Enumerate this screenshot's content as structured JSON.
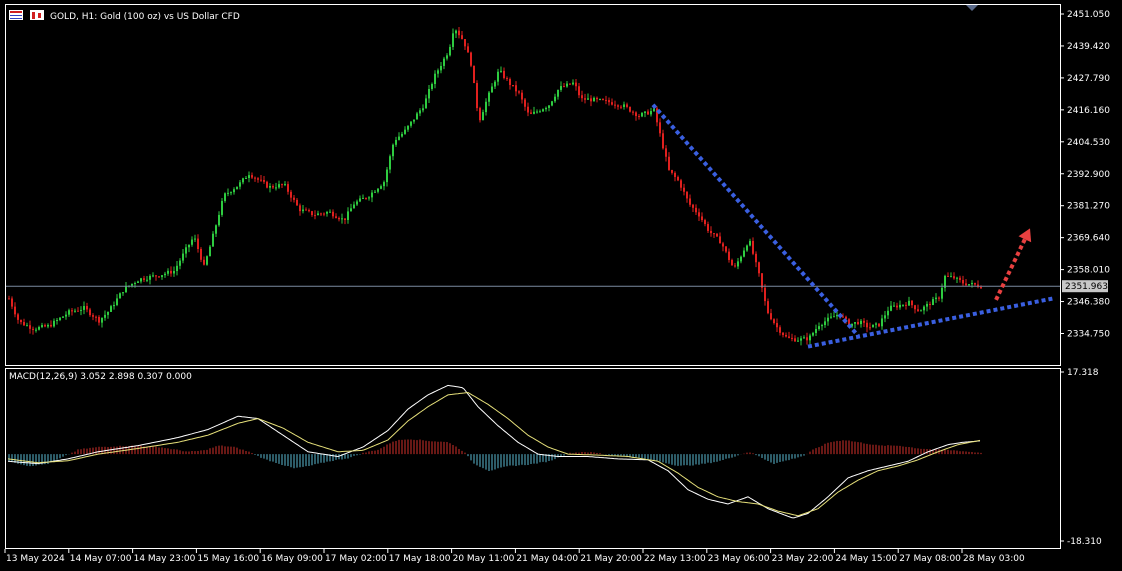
{
  "header": {
    "symbol_line": "GOLD, H1:  Gold (100 oz) vs US Dollar CFD"
  },
  "macd_label": "MACD(12,26,9) 3.052 2.898 0.307 0.000",
  "colors": {
    "background": "#000000",
    "bull_candle": "#2ecc40",
    "bear_candle": "#e0201e",
    "trendline": "#3a5fe0",
    "projection_arrow": "#e84040",
    "macd_line": "#ffffff",
    "signal_line": "#e6e07a",
    "hist_positive": "#d0302a",
    "hist_negative": "#5ab8d0",
    "current_price_bg": "#c8c8c8",
    "grid_frame": "#ffffff"
  },
  "chart_data": [
    {
      "type": "candlestick",
      "title": "GOLD, H1:  Gold (100 oz) vs US Dollar CFD",
      "timeframe": "H1",
      "ylim": [
        2329.0,
        2453.0
      ],
      "yticks": [
        "2451.050",
        "2439.420",
        "2427.790",
        "2416.160",
        "2404.530",
        "2392.900",
        "2381.270",
        "2369.640",
        "2358.010",
        "2346.380",
        "2334.750"
      ],
      "current_price": "2351.963",
      "current_price_value": 2351.963,
      "xticks": [
        "13 May 2024",
        "14 May 07:00",
        "14 May 23:00",
        "15 May 16:00",
        "16 May 09:00",
        "17 May 02:00",
        "17 May 18:00",
        "20 May 11:00",
        "21 May 04:00",
        "21 May 20:00",
        "22 May 13:00",
        "23 May 06:00",
        "23 May 22:00",
        "24 May 15:00",
        "27 May 08:00",
        "28 May 03:00"
      ],
      "close_path": [
        [
          0,
          2347.5
        ],
        [
          10,
          2339.0
        ],
        [
          25,
          2336.5
        ],
        [
          40,
          2337.5
        ],
        [
          60,
          2342.5
        ],
        [
          75,
          2344.0
        ],
        [
          90,
          2339.5
        ],
        [
          100,
          2343.0
        ],
        [
          115,
          2351.0
        ],
        [
          130,
          2354.5
        ],
        [
          150,
          2356.0
        ],
        [
          165,
          2357.5
        ],
        [
          178,
          2366.0
        ],
        [
          185,
          2370.0
        ],
        [
          195,
          2359.0
        ],
        [
          200,
          2365.0
        ],
        [
          215,
          2385.0
        ],
        [
          230,
          2389.0
        ],
        [
          240,
          2393.0
        ],
        [
          260,
          2388.0
        ],
        [
          275,
          2389.0
        ],
        [
          290,
          2380.0
        ],
        [
          305,
          2378.0
        ],
        [
          320,
          2379.0
        ],
        [
          335,
          2376.0
        ],
        [
          345,
          2382.0
        ],
        [
          360,
          2385.0
        ],
        [
          375,
          2390.0
        ],
        [
          385,
          2405.0
        ],
        [
          395,
          2408.0
        ],
        [
          405,
          2413.0
        ],
        [
          415,
          2418.0
        ],
        [
          425,
          2428.0
        ],
        [
          440,
          2438.0
        ],
        [
          445,
          2446.5
        ],
        [
          455,
          2441.0
        ],
        [
          462,
          2433.0
        ],
        [
          470,
          2412.0
        ],
        [
          478,
          2420.0
        ],
        [
          490,
          2430.5
        ],
        [
          500,
          2426.0
        ],
        [
          510,
          2422.0
        ],
        [
          520,
          2414.0
        ],
        [
          530,
          2416.0
        ],
        [
          540,
          2418.0
        ],
        [
          550,
          2424.0
        ],
        [
          565,
          2426.0
        ],
        [
          572,
          2420.0
        ],
        [
          580,
          2420.0
        ],
        [
          600,
          2419.0
        ],
        [
          615,
          2417.5
        ],
        [
          630,
          2414.0
        ],
        [
          645,
          2416.0
        ],
        [
          660,
          2394.0
        ],
        [
          670,
          2390.0
        ],
        [
          680,
          2382.0
        ],
        [
          690,
          2378.0
        ],
        [
          700,
          2372.0
        ],
        [
          712,
          2368.0
        ],
        [
          725,
          2358.0
        ],
        [
          740,
          2369.0
        ],
        [
          750,
          2356.0
        ],
        [
          758,
          2343.0
        ],
        [
          768,
          2337.0
        ],
        [
          778,
          2333.0
        ],
        [
          790,
          2332.5
        ],
        [
          800,
          2333.0
        ],
        [
          810,
          2338.0
        ],
        [
          820,
          2340.0
        ],
        [
          830,
          2342.0
        ],
        [
          840,
          2338.0
        ],
        [
          850,
          2339.0
        ],
        [
          860,
          2337.0
        ],
        [
          870,
          2338.0
        ],
        [
          880,
          2344.0
        ],
        [
          890,
          2345.0
        ],
        [
          900,
          2346.0
        ],
        [
          910,
          2343.0
        ],
        [
          920,
          2345.5
        ],
        [
          930,
          2348.0
        ],
        [
          936,
          2355.5
        ],
        [
          945,
          2355.0
        ],
        [
          955,
          2353.0
        ],
        [
          965,
          2352.5
        ],
        [
          972,
          2352.0
        ]
      ],
      "annotations": [
        {
          "kind": "dotted-trendline",
          "from": [
            645,
            2418.0
          ],
          "to": [
            850,
            2334.0
          ]
        },
        {
          "kind": "dotted-trendline",
          "from": [
            800,
            2330.0
          ],
          "to": [
            1045,
            2347.5
          ]
        },
        {
          "kind": "dotted-arrow",
          "from": [
            988,
            2347.0
          ],
          "to": [
            1022,
            2373.0
          ]
        }
      ]
    },
    {
      "type": "macd",
      "title": "MACD(12,26,9) 3.052 2.898 0.307 0.000",
      "ylim": [
        -18.31,
        17.318
      ],
      "yticks": [
        "17.318",
        "-18.310"
      ],
      "series": [
        {
          "name": "MACD",
          "values": [
            [
              0,
              -1.5
            ],
            [
              30,
              -2.0
            ],
            [
              60,
              -1.0
            ],
            [
              90,
              0.5
            ],
            [
              130,
              1.8
            ],
            [
              170,
              3.5
            ],
            [
              200,
              5.2
            ],
            [
              230,
              8.0
            ],
            [
              250,
              7.5
            ],
            [
              275,
              4.0
            ],
            [
              300,
              0.5
            ],
            [
              330,
              -0.5
            ],
            [
              355,
              1.5
            ],
            [
              380,
              5.0
            ],
            [
              400,
              9.5
            ],
            [
              420,
              12.5
            ],
            [
              440,
              14.5
            ],
            [
              455,
              14.0
            ],
            [
              470,
              10.0
            ],
            [
              490,
              6.0
            ],
            [
              510,
              2.5
            ],
            [
              530,
              0.0
            ],
            [
              550,
              -0.5
            ],
            [
              580,
              -0.5
            ],
            [
              610,
              -1.0
            ],
            [
              640,
              -1.2
            ],
            [
              660,
              -3.5
            ],
            [
              680,
              -7.5
            ],
            [
              700,
              -9.5
            ],
            [
              720,
              -10.5
            ],
            [
              740,
              -9.0
            ],
            [
              760,
              -11.5
            ],
            [
              785,
              -13.5
            ],
            [
              800,
              -12.5
            ],
            [
              820,
              -9.0
            ],
            [
              840,
              -5.0
            ],
            [
              860,
              -3.5
            ],
            [
              880,
              -2.5
            ],
            [
              900,
              -1.5
            ],
            [
              920,
              0.5
            ],
            [
              940,
              2.0
            ],
            [
              955,
              2.5
            ],
            [
              972,
              2.8
            ]
          ]
        },
        {
          "name": "Signal",
          "values": [
            [
              0,
              -1.0
            ],
            [
              30,
              -1.8
            ],
            [
              60,
              -1.4
            ],
            [
              90,
              0.0
            ],
            [
              130,
              1.2
            ],
            [
              170,
              2.5
            ],
            [
              200,
              4.0
            ],
            [
              230,
              6.5
            ],
            [
              250,
              7.5
            ],
            [
              275,
              5.5
            ],
            [
              300,
              2.5
            ],
            [
              330,
              0.5
            ],
            [
              355,
              0.8
            ],
            [
              380,
              3.0
            ],
            [
              400,
              7.0
            ],
            [
              420,
              10.0
            ],
            [
              440,
              12.5
            ],
            [
              460,
              13.0
            ],
            [
              480,
              10.5
            ],
            [
              500,
              7.5
            ],
            [
              520,
              4.0
            ],
            [
              540,
              1.5
            ],
            [
              560,
              0.0
            ],
            [
              590,
              -0.2
            ],
            [
              620,
              -0.5
            ],
            [
              650,
              -1.5
            ],
            [
              670,
              -4.0
            ],
            [
              690,
              -7.0
            ],
            [
              710,
              -9.0
            ],
            [
              730,
              -10.0
            ],
            [
              750,
              -10.5
            ],
            [
              770,
              -12.0
            ],
            [
              790,
              -13.0
            ],
            [
              810,
              -11.5
            ],
            [
              830,
              -8.0
            ],
            [
              850,
              -5.5
            ],
            [
              870,
              -3.5
            ],
            [
              890,
              -2.5
            ],
            [
              910,
              -1.2
            ],
            [
              930,
              0.5
            ],
            [
              950,
              2.0
            ],
            [
              972,
              2.9
            ]
          ]
        },
        {
          "name": "Histogram",
          "values": [
            [
              0,
              -1.5
            ],
            [
              20,
              -2.5
            ],
            [
              40,
              -2.0
            ],
            [
              55,
              -0.5
            ],
            [
              70,
              1.0
            ],
            [
              90,
              1.5
            ],
            [
              110,
              1.7
            ],
            [
              130,
              1.8
            ],
            [
              150,
              1.5
            ],
            [
              165,
              1.0
            ],
            [
              180,
              0.5
            ],
            [
              195,
              0.8
            ],
            [
              210,
              1.8
            ],
            [
              225,
              1.5
            ],
            [
              240,
              0.5
            ],
            [
              255,
              -1.0
            ],
            [
              270,
              -2.0
            ],
            [
              285,
              -3.0
            ],
            [
              300,
              -2.5
            ],
            [
              320,
              -1.5
            ],
            [
              340,
              -0.8
            ],
            [
              355,
              0.3
            ],
            [
              370,
              1.0
            ],
            [
              385,
              2.8
            ],
            [
              400,
              3.2
            ],
            [
              420,
              2.8
            ],
            [
              440,
              2.5
            ],
            [
              455,
              0.5
            ],
            [
              465,
              -2.0
            ],
            [
              480,
              -3.5
            ],
            [
              500,
              -2.5
            ],
            [
              520,
              -2.2
            ],
            [
              540,
              -1.5
            ],
            [
              560,
              0.2
            ],
            [
              575,
              0.5
            ],
            [
              590,
              0.2
            ],
            [
              610,
              -0.5
            ],
            [
              630,
              -0.8
            ],
            [
              650,
              -1.5
            ],
            [
              670,
              -2.5
            ],
            [
              690,
              -2.2
            ],
            [
              710,
              -1.5
            ],
            [
              725,
              -0.5
            ],
            [
              740,
              0.5
            ],
            [
              750,
              -0.5
            ],
            [
              765,
              -2.0
            ],
            [
              780,
              -1.2
            ],
            [
              795,
              -0.3
            ],
            [
              805,
              1.0
            ],
            [
              820,
              2.5
            ],
            [
              835,
              3.0
            ],
            [
              850,
              2.5
            ],
            [
              870,
              1.8
            ],
            [
              890,
              1.8
            ],
            [
              910,
              1.2
            ],
            [
              925,
              1.0
            ],
            [
              945,
              0.8
            ],
            [
              960,
              0.5
            ],
            [
              972,
              0.3
            ]
          ]
        }
      ]
    }
  ]
}
